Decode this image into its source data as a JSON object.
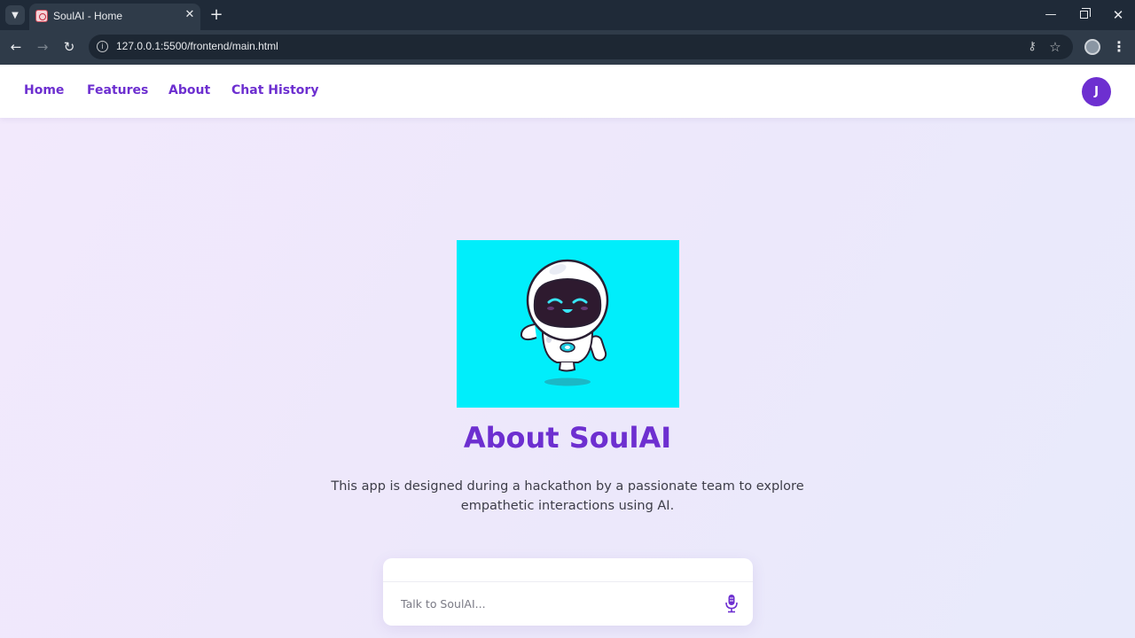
{
  "browser": {
    "tab_title": "SoulAI - Home",
    "url": "127.0.0.1:5500/frontend/main.html",
    "icons": {
      "tab_list": "chevron-down-icon",
      "close_tab": "close-icon",
      "new_tab": "plus-icon",
      "back": "arrow-left-icon",
      "forward": "arrow-right-icon",
      "reload": "reload-icon",
      "site_info": "info-icon",
      "passwords": "key-icon",
      "bookmark": "star-icon",
      "profile": "profile-icon",
      "menu": "more-vertical-icon"
    }
  },
  "nav": {
    "items": [
      {
        "label": "Home"
      },
      {
        "label": "Features"
      },
      {
        "label": "About"
      },
      {
        "label": "Chat History"
      }
    ],
    "avatar_initial": "J"
  },
  "hero": {
    "image": "robot-mascot-illustration",
    "title": "About SoulAI",
    "description": "This app is designed during a hackathon by a passionate team to explore empathetic interactions using AI."
  },
  "chat": {
    "placeholder": "Talk to SoulAI...",
    "mic_icon": "microphone-icon"
  },
  "colors": {
    "accent": "#6d2fd0",
    "image_background": "#00eefb",
    "page_background": "#efe9fb"
  }
}
